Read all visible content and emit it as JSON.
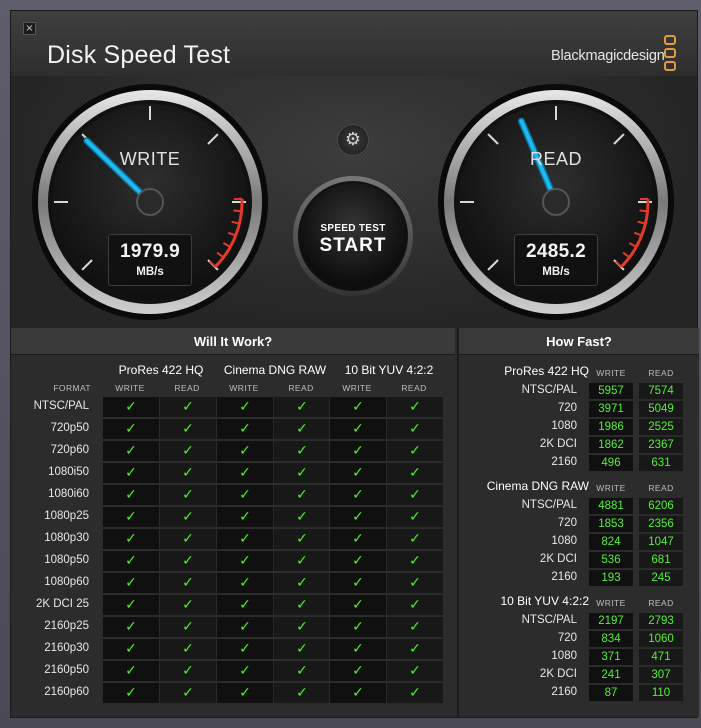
{
  "window": {
    "close_label": "×"
  },
  "app_title": "Disk Speed Test",
  "brand": "Blackmagicdesign",
  "gauges": {
    "write": {
      "label": "WRITE",
      "value": "1979.9",
      "unit": "MB/s"
    },
    "read": {
      "label": "READ",
      "value": "2485.2",
      "unit": "MB/s"
    }
  },
  "start_button": {
    "line1": "SPEED TEST",
    "line2": "START"
  },
  "settings_icon": "gear-icon",
  "will_it_work": {
    "title": "Will It Work?",
    "format_label": "FORMAT",
    "write_label": "WRITE",
    "read_label": "READ",
    "codecs": [
      "ProRes 422 HQ",
      "Cinema DNG RAW",
      "10 Bit YUV 4:2:2"
    ],
    "check_glyph": "✓",
    "formats": [
      "NTSC/PAL",
      "720p50",
      "720p60",
      "1080i50",
      "1080i60",
      "1080p25",
      "1080p30",
      "1080p50",
      "1080p60",
      "2K DCI 25",
      "2160p25",
      "2160p30",
      "2160p50",
      "2160p60"
    ]
  },
  "how_fast": {
    "title": "How Fast?",
    "write_label": "WRITE",
    "read_label": "READ",
    "groups": [
      {
        "codec": "ProRes 422 HQ",
        "rows": [
          {
            "format": "NTSC/PAL",
            "write": "5957",
            "read": "7574"
          },
          {
            "format": "720",
            "write": "3971",
            "read": "5049"
          },
          {
            "format": "1080",
            "write": "1986",
            "read": "2525"
          },
          {
            "format": "2K DCI",
            "write": "1862",
            "read": "2367"
          },
          {
            "format": "2160",
            "write": "496",
            "read": "631"
          }
        ]
      },
      {
        "codec": "Cinema DNG RAW",
        "rows": [
          {
            "format": "NTSC/PAL",
            "write": "4881",
            "read": "6206"
          },
          {
            "format": "720",
            "write": "1853",
            "read": "2356"
          },
          {
            "format": "1080",
            "write": "824",
            "read": "1047"
          },
          {
            "format": "2K DCI",
            "write": "536",
            "read": "681"
          },
          {
            "format": "2160",
            "write": "193",
            "read": "245"
          }
        ]
      },
      {
        "codec": "10 Bit YUV 4:2:2",
        "rows": [
          {
            "format": "NTSC/PAL",
            "write": "2197",
            "read": "2793"
          },
          {
            "format": "720",
            "write": "834",
            "read": "1060"
          },
          {
            "format": "1080",
            "write": "371",
            "read": "471"
          },
          {
            "format": "2K DCI",
            "write": "241",
            "read": "307"
          },
          {
            "format": "2160",
            "write": "87",
            "read": "110"
          }
        ]
      }
    ]
  },
  "colors": {
    "accent_needle": "#1fb8f2",
    "check_green": "#4df229",
    "brand_orange": "#e19b3c",
    "redline": "#e33a2a"
  }
}
